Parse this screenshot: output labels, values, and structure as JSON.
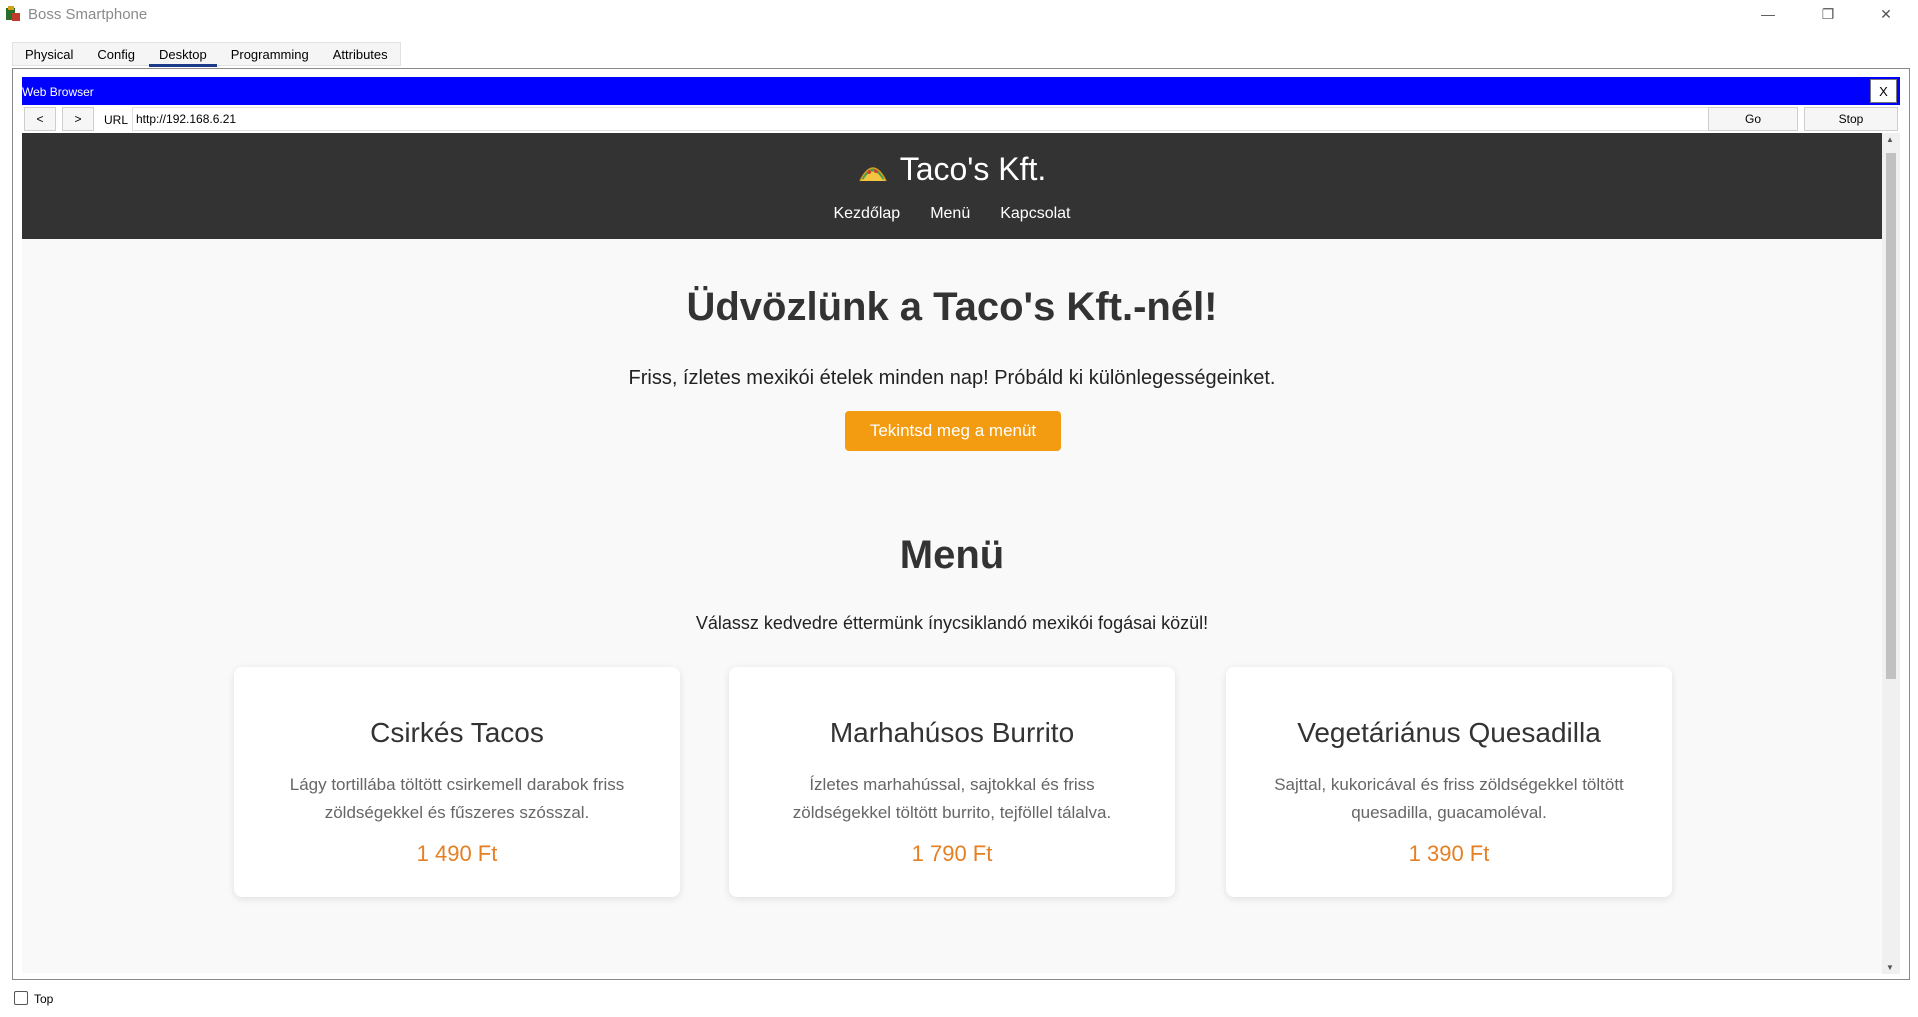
{
  "window": {
    "title": "Boss Smartphone",
    "minimize_glyph": "—",
    "maximize_glyph": "❐",
    "close_glyph": "✕"
  },
  "tabs": [
    {
      "label": "Physical"
    },
    {
      "label": "Config"
    },
    {
      "label": "Desktop",
      "active": true
    },
    {
      "label": "Programming"
    },
    {
      "label": "Attributes"
    }
  ],
  "browser": {
    "title": "Web Browser",
    "close_label": "X",
    "back_label": "<",
    "forward_label": ">",
    "url_label": "URL",
    "url_value": "http://192.168.6.21",
    "go_label": "Go",
    "stop_label": "Stop"
  },
  "site": {
    "brand": "Taco's Kft.",
    "brand_icon": "taco-icon",
    "nav": [
      "Kezdőlap",
      "Menü",
      "Kapcsolat"
    ],
    "hero_title": "Üdvözlünk a Taco's Kft.-nél!",
    "hero_text": "Friss, ízletes mexikói ételek minden nap! Próbáld ki különlegességeinket.",
    "cta_label": "Tekintsd meg a menüt",
    "menu_title": "Menü",
    "menu_subtitle": "Válassz kedvedre éttermünk ínycsiklandó mexikói fogásai közül!",
    "items": [
      {
        "name": "Csirkés Tacos",
        "description": "Lágy tortillába töltött csirkemell darabok friss zöldségekkel és fűszeres szósszal.",
        "price": "1 490 Ft"
      },
      {
        "name": "Marhahúsos Burrito",
        "description": "Ízletes marhahússal, sajtokkal és friss zöldségekkel töltött burrito, tejföllel tálalva.",
        "price": "1 790 Ft"
      },
      {
        "name": "Vegetáriánus Quesadilla",
        "description": "Sajttal, kukoricával és friss zöldségekkel töltött quesadilla, guacamoléval.",
        "price": "1 390 Ft"
      }
    ]
  },
  "colors": {
    "header_bg": "#333333",
    "accent": "#f39c12",
    "price": "#e67e22",
    "browser_title_bg": "#0000ff"
  },
  "footer": {
    "top_label": "Top",
    "top_checked": false
  }
}
